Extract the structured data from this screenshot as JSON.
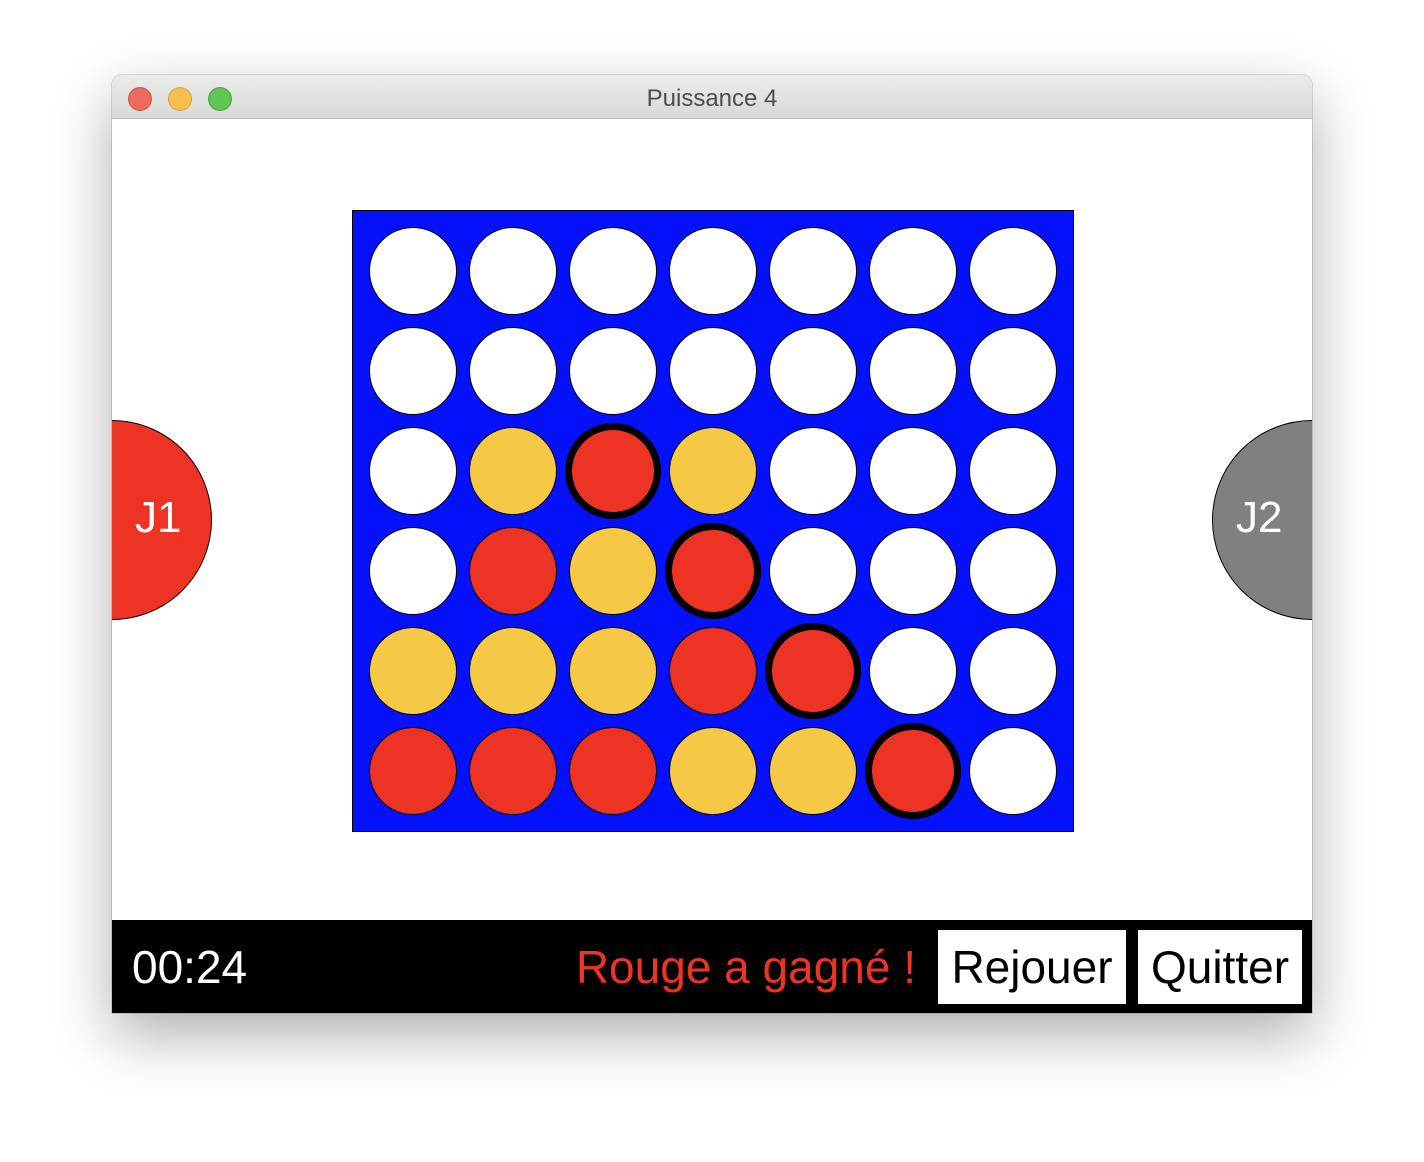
{
  "window": {
    "title": "Puissance 4"
  },
  "players": {
    "j1": {
      "label": "J1",
      "color": "#ed3324"
    },
    "j2": {
      "label": "J2",
      "color": "#808080"
    }
  },
  "board": {
    "columns": 7,
    "rows": 6,
    "colors": {
      "red": "#ed3324",
      "yellow": "#f5c945",
      "empty": "#ffffff",
      "board": "#0510fb"
    },
    "cells": [
      [
        "empty",
        "empty",
        "empty",
        "empty",
        "empty",
        "empty",
        "empty"
      ],
      [
        "empty",
        "empty",
        "empty",
        "empty",
        "empty",
        "empty",
        "empty"
      ],
      [
        "empty",
        "yellow",
        "red",
        "yellow",
        "empty",
        "empty",
        "empty"
      ],
      [
        "empty",
        "red",
        "yellow",
        "red",
        "empty",
        "empty",
        "empty"
      ],
      [
        "yellow",
        "yellow",
        "yellow",
        "red",
        "red",
        "empty",
        "empty"
      ],
      [
        "red",
        "red",
        "red",
        "yellow",
        "yellow",
        "red",
        "empty"
      ]
    ],
    "winning_cells": [
      [
        2,
        2
      ],
      [
        3,
        3
      ],
      [
        4,
        4
      ],
      [
        5,
        5
      ]
    ]
  },
  "footer": {
    "timer": "00:24",
    "status": "Rouge a gagné !",
    "replay_label": "Rejouer",
    "quit_label": "Quitter"
  }
}
